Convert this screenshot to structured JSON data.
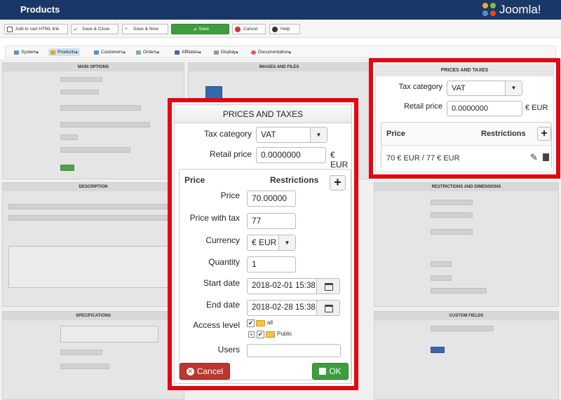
{
  "header": {
    "title": "Products",
    "brand": "Joomla!"
  },
  "toolbar": {
    "add_to_cart": "Add to cart HTML link",
    "save_close": "Save & Close",
    "save_new": "Save & New",
    "save": "Save",
    "cancel": "Cancel",
    "help": "Help"
  },
  "menu": [
    "System",
    "Products",
    "Customers",
    "Orders",
    "Affiliates",
    "Display",
    "Documentation"
  ],
  "background_panels": {
    "main_options": "MAIN OPTIONS",
    "images_files": "IMAGES AND FILES",
    "description": "DESCRIPTION",
    "specifications": "SPECIFICATIONS",
    "restrictions": "RESTRICTIONS AND DIMENSIONS",
    "custom_fields": "CUSTOM FIELDS"
  },
  "prices_panel": {
    "title": "PRICES AND TAXES",
    "tax_category_label": "Tax category",
    "tax_category_value": "VAT",
    "retail_price_label": "Retail price",
    "retail_price_value": "0.0000000",
    "currency_unit": "€ EUR",
    "col_price": "Price",
    "col_restrictions": "Restrictions",
    "row_price": "70 € EUR / 77 € EUR"
  },
  "popup": {
    "title": "PRICES AND TAXES",
    "tax_category_label": "Tax category",
    "tax_category_value": "VAT",
    "retail_price_label": "Retail price",
    "retail_price_value": "0.0000000",
    "currency_unit": "€ EUR",
    "col_price": "Price",
    "col_restrictions": "Restrictions",
    "price_label": "Price",
    "price_value": "70.00000",
    "price_tax_label": "Price with tax",
    "price_tax_value": "77",
    "currency_label": "Currency",
    "currency_value": "€ EUR",
    "quantity_label": "Quantity",
    "quantity_value": "1",
    "start_date_label": "Start date",
    "start_date_value": "2018-02-01 15:38",
    "end_date_label": "End date",
    "end_date_value": "2018-02-28 15:38",
    "access_level_label": "Access level",
    "access_all": "all",
    "access_public": "Public",
    "users_label": "Users",
    "users_value": "",
    "cancel_label": "Cancel",
    "ok_label": "OK"
  },
  "colors": {
    "header": "#1a3867",
    "highlight": "#e30613",
    "ok": "#3e9d3e",
    "cancel": "#bd362f"
  }
}
